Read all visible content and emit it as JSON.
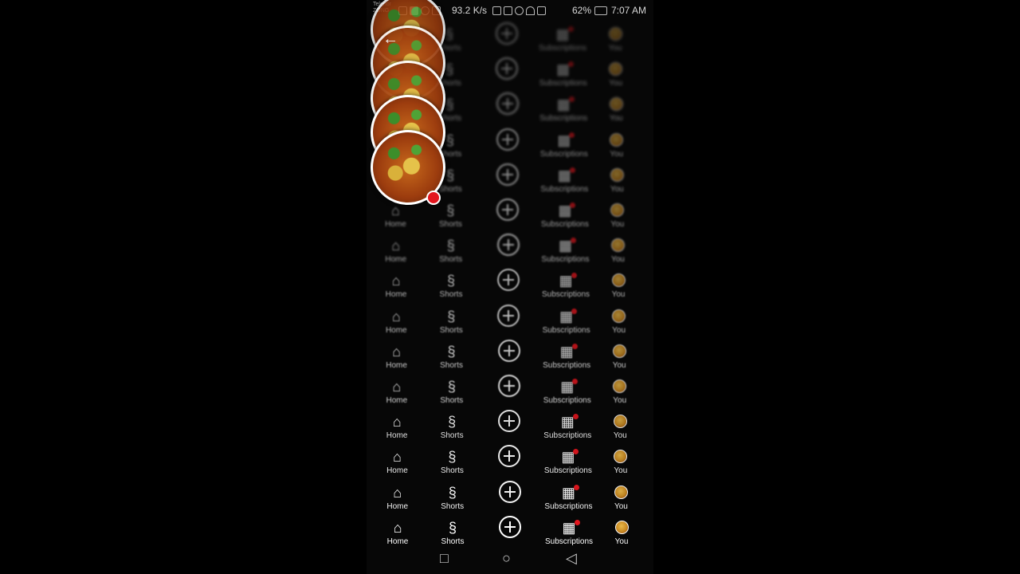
{
  "status_bar": {
    "carrier_1": "Telenor",
    "carrier_2": "ZONG",
    "network_speed": "93.2 K/s",
    "battery": "62%",
    "time": "7:07 AM"
  },
  "bottom_nav": {
    "home": "Home",
    "shorts": "Shorts",
    "subscriptions": "Subscriptions",
    "you": "You"
  },
  "icons": {
    "back": "back-arrow-icon",
    "home": "home-icon",
    "shorts": "shorts-icon",
    "create": "create-plus-icon",
    "subscriptions": "subscriptions-icon",
    "profile": "profile-avatar-icon",
    "system_recent": "square-icon",
    "system_home": "circle-icon",
    "system_back": "triangle-back-icon"
  },
  "colors": {
    "notification_red": "#e3161e",
    "background": "#070707",
    "text": "#ffffff"
  }
}
